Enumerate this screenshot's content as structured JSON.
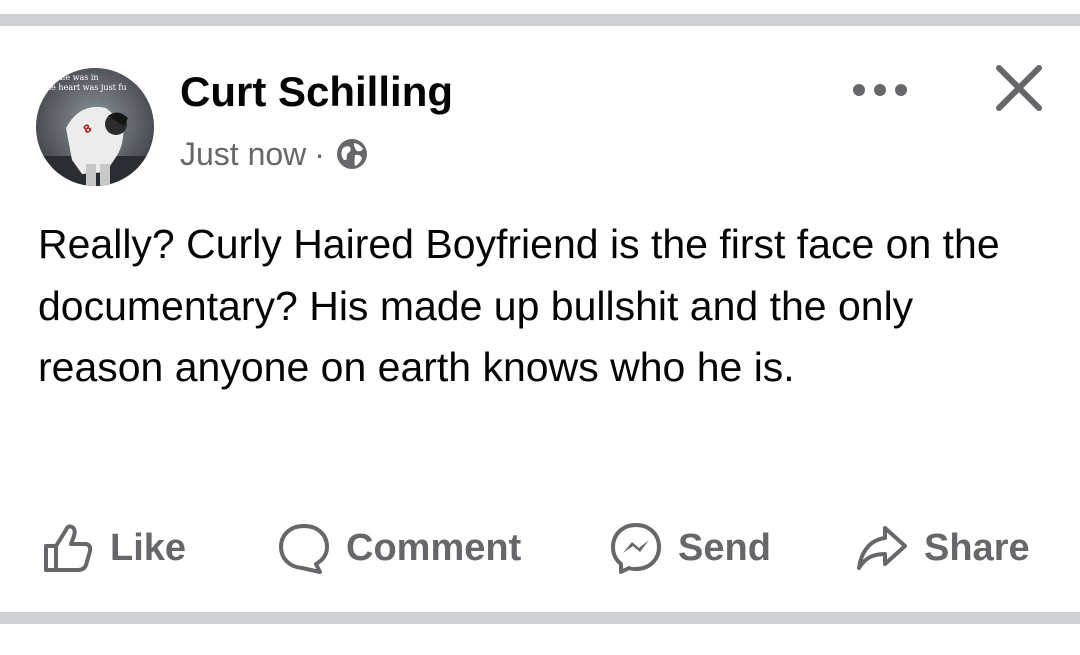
{
  "post": {
    "author": "Curt Schilling",
    "timestamp": "Just now",
    "separator": "·",
    "privacy_icon": "globe-icon",
    "body": "Really? Curly Haired Boyfriend is the first face on the documentary? His made up bullshit and the only reason anyone on earth knows who he is.",
    "avatar_caption_line1": "ale was in",
    "avatar_caption_line2": "he heart was just fu"
  },
  "header_actions": {
    "more_icon": "more-horizontal-icon",
    "close_icon": "close-icon"
  },
  "actions": [
    {
      "label": "Like",
      "icon": "thumbs-up-icon"
    },
    {
      "label": "Comment",
      "icon": "comment-bubble-icon"
    },
    {
      "label": "Send",
      "icon": "messenger-icon"
    },
    {
      "label": "Share",
      "icon": "share-arrow-icon"
    }
  ],
  "colors": {
    "text_primary": "#050505",
    "text_secondary": "#65676b",
    "divider": "#ced0d4",
    "background": "#ffffff"
  }
}
